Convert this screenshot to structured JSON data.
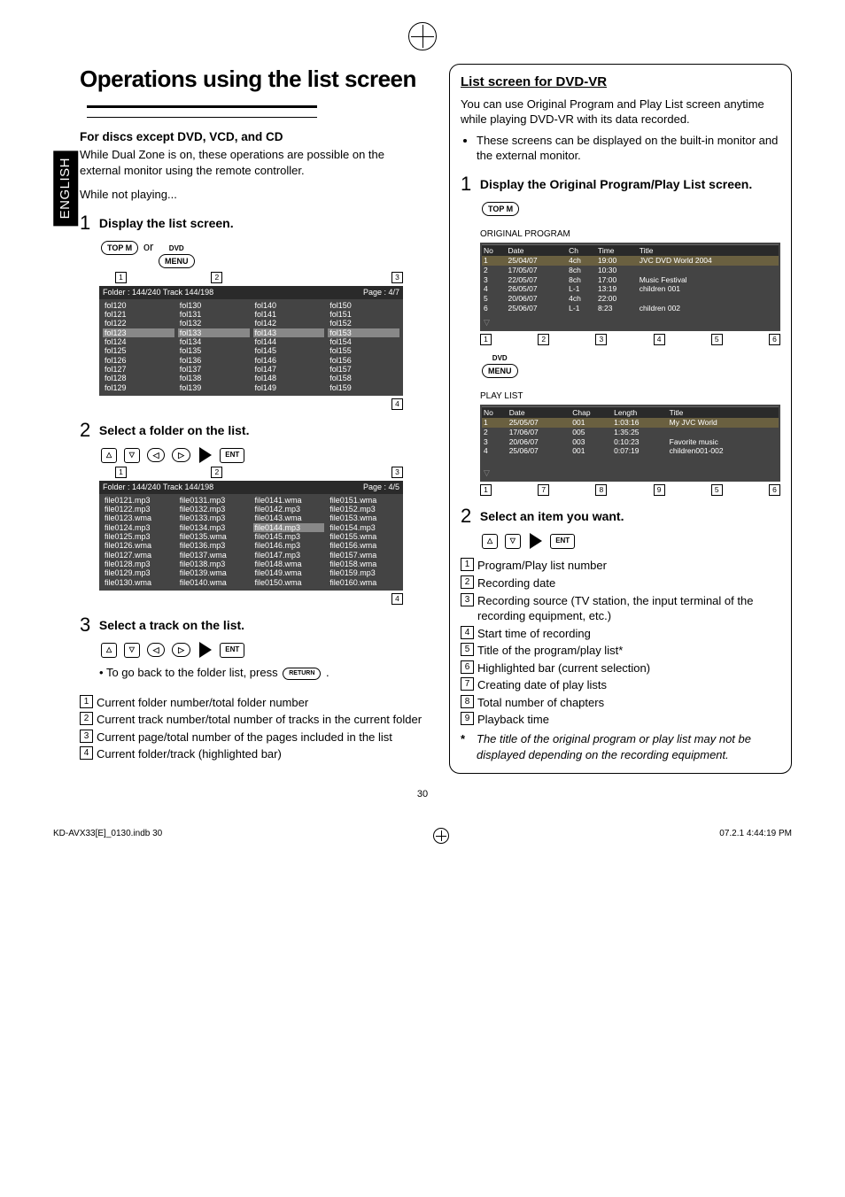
{
  "side_tab": "ENGLISH",
  "left": {
    "heading": "Operations using the list screen",
    "sub1": "For discs except DVD, VCD, and CD",
    "para1": "While Dual Zone is on, these operations are possible on the external monitor using the remote controller.",
    "para2": "While not playing...",
    "step1": {
      "num": "1",
      "title": "Display the list screen."
    },
    "step2": {
      "num": "2",
      "title": "Select a folder on the list."
    },
    "step3": {
      "num": "3",
      "title": "Select a track on the list."
    },
    "btn_topm": "TOP M",
    "btn_or": "or",
    "btn_dvd": "DVD",
    "btn_menu": "MENU",
    "folder_header_left": "Folder : 144/240  Track 144/198",
    "folder_header_right": "Page : 4/7",
    "folder_cols": [
      [
        "fol120",
        "fol121",
        "fol122",
        "fol123",
        "fol124",
        "fol125",
        "fol126",
        "fol127",
        "fol128",
        "fol129"
      ],
      [
        "fol130",
        "fol131",
        "fol132",
        "fol133",
        "fol134",
        "fol135",
        "fol136",
        "fol137",
        "fol138",
        "fol139"
      ],
      [
        "fol140",
        "fol141",
        "fol142",
        "fol143",
        "fol144",
        "fol145",
        "fol146",
        "fol147",
        "fol148",
        "fol149"
      ],
      [
        "fol150",
        "fol151",
        "fol152",
        "fol153",
        "fol154",
        "fol155",
        "fol156",
        "fol157",
        "fol158",
        "fol159"
      ]
    ],
    "folder_hl_row": 3,
    "track_header_left": "Folder : 144/240  Track 144/198",
    "track_header_right": "Page : 4/5",
    "track_cols": [
      [
        "file0121.mp3",
        "file0122.mp3",
        "file0123.wma",
        "file0124.mp3",
        "file0125.mp3",
        "file0126.wma",
        "file0127.wma",
        "file0128.mp3",
        "file0129.mp3",
        "file0130.wma"
      ],
      [
        "file0131.mp3",
        "file0132.mp3",
        "file0133.mp3",
        "file0134.mp3",
        "file0135.wma",
        "file0136.mp3",
        "file0137.wma",
        "file0138.mp3",
        "file0139.wma",
        "file0140.wma"
      ],
      [
        "file0141.wma",
        "file0142.mp3",
        "file0143.wma",
        "file0144.mp3",
        "file0145.mp3",
        "file0146.mp3",
        "file0147.mp3",
        "file0148.wma",
        "file0149.wma",
        "file0150.wma"
      ],
      [
        "file0151.wma",
        "file0152.mp3",
        "file0153.wma",
        "file0154.mp3",
        "file0155.wma",
        "file0156.wma",
        "file0157.wma",
        "file0158.wma",
        "file0159.mp3",
        "file0160.wma"
      ]
    ],
    "track_hl_row": 3,
    "return_line_a": "To go back to the folder list, press ",
    "return_btn": "RETURN",
    "return_line_b": ".",
    "btn_ent": "ENT",
    "callout_labels": {
      "1": "1",
      "2": "2",
      "3": "3",
      "4": "4"
    },
    "legend": [
      {
        "n": "1",
        "t": "Current folder number/total folder number"
      },
      {
        "n": "2",
        "t": "Current track number/total number of tracks in the current folder"
      },
      {
        "n": "3",
        "t": "Current page/total number of the pages included in the list"
      },
      {
        "n": "4",
        "t": "Current folder/track (highlighted bar)"
      }
    ]
  },
  "right": {
    "title": "List screen for DVD-VR",
    "para1": "You can use Original Program and Play List screen anytime while playing DVD-VR with its data recorded.",
    "bullet": "These screens can be displayed on the built-in monitor and the external monitor.",
    "step1": {
      "num": "1",
      "title": "Display the Original Program/Play List screen."
    },
    "btn_topm": "TOP M",
    "panel_a_title": "ORIGINAL PROGRAM",
    "panel_a_head": [
      "No",
      "Date",
      "Ch",
      "Time",
      "Title"
    ],
    "panel_a_rows": [
      [
        "1",
        "25/04/07",
        "4ch",
        "19:00",
        "JVC DVD World 2004"
      ],
      [
        "2",
        "17/05/07",
        "8ch",
        "10:30",
        ""
      ],
      [
        "3",
        "22/05/07",
        "8ch",
        "17:00",
        "Music Festival"
      ],
      [
        "4",
        "26/05/07",
        "L-1",
        "13:19",
        "children 001"
      ],
      [
        "5",
        "20/06/07",
        "4ch",
        "22:00",
        ""
      ],
      [
        "6",
        "25/06/07",
        "L-1",
        "8:23",
        "children 002"
      ]
    ],
    "panel_a_callouts": [
      "1",
      "2",
      "3",
      "4",
      "5",
      "6"
    ],
    "mid_btn_dvd": "DVD",
    "mid_btn_menu": "MENU",
    "panel_b_title": "PLAY LIST",
    "panel_b_head": [
      "No",
      "Date",
      "Chap",
      "Length",
      "Title"
    ],
    "panel_b_rows": [
      [
        "1",
        "25/05/07",
        "001",
        "1:03:16",
        "My JVC World"
      ],
      [
        "2",
        "17/06/07",
        "005",
        "1:35:25",
        ""
      ],
      [
        "3",
        "20/06/07",
        "003",
        "0:10:23",
        "Favorite music"
      ],
      [
        "4",
        "25/06/07",
        "001",
        "0:07:19",
        "children001-002"
      ]
    ],
    "panel_b_callouts": [
      "1",
      "7",
      "8",
      "9",
      "5",
      "6"
    ],
    "step2": {
      "num": "2",
      "title": "Select an item you want."
    },
    "btn_ent": "ENT",
    "legend": [
      {
        "n": "1",
        "t": "Program/Play list number"
      },
      {
        "n": "2",
        "t": "Recording date"
      },
      {
        "n": "3",
        "t": "Recording source (TV station, the input terminal of the recording equipment, etc.)"
      },
      {
        "n": "4",
        "t": "Start time of recording"
      },
      {
        "n": "5",
        "t": "Title of the program/play list*"
      },
      {
        "n": "6",
        "t": "Highlighted bar (current selection)"
      },
      {
        "n": "7",
        "t": "Creating date of play lists"
      },
      {
        "n": "8",
        "t": "Total number of chapters"
      },
      {
        "n": "9",
        "t": "Playback time"
      }
    ],
    "asterisk": "*",
    "asterisk_note": "The title of the original program or play list may not be displayed depending on the recording equipment."
  },
  "page_num": "30",
  "footer_left": "KD-AVX33[E]_0130.indb   30",
  "footer_right": "07.2.1   4:44:19 PM"
}
